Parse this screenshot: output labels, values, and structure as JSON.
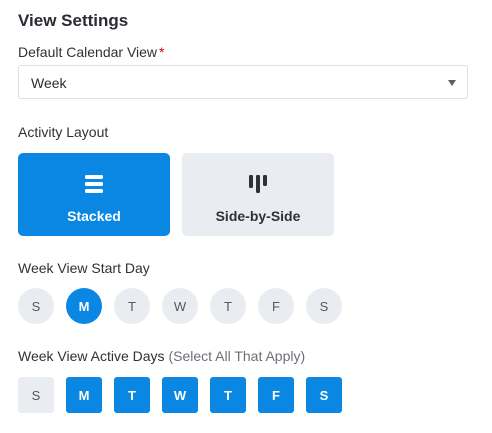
{
  "section": {
    "title": "View Settings"
  },
  "default_view": {
    "label": "Default Calendar View",
    "required_mark": "*",
    "value": "Week"
  },
  "activity_layout": {
    "label": "Activity Layout",
    "options": [
      {
        "label": "Stacked",
        "icon": "stacked-rows-icon",
        "selected": true
      },
      {
        "label": "Side-by-Side",
        "icon": "side-by-side-columns-icon",
        "selected": false
      }
    ]
  },
  "start_day": {
    "label": "Week View Start Day",
    "days": [
      "S",
      "M",
      "T",
      "W",
      "T",
      "F",
      "S"
    ],
    "selected_index": 1
  },
  "active_days": {
    "label": "Week View Active Days",
    "hint": "(Select All That Apply)",
    "days": [
      "S",
      "M",
      "T",
      "W",
      "T",
      "F",
      "S"
    ],
    "selected": [
      false,
      true,
      true,
      true,
      true,
      true,
      true
    ]
  },
  "colors": {
    "accent": "#0a87e3",
    "inactive": "#e9edf1",
    "required": "#d0021b"
  }
}
